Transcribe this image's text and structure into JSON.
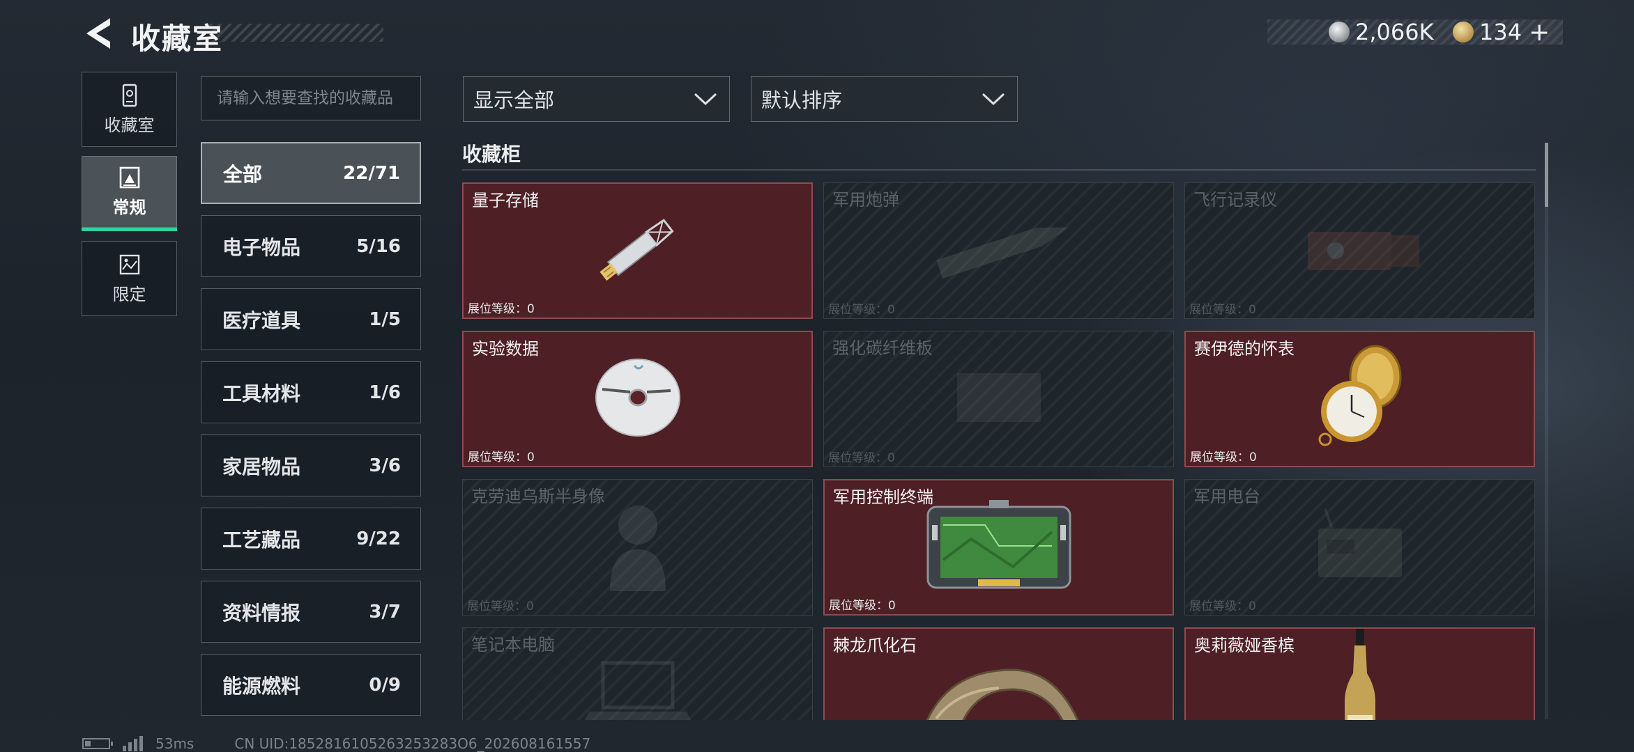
{
  "header": {
    "title": "收藏室",
    "currencies": [
      {
        "icon": "silver-coin-icon",
        "value": "2,066K"
      },
      {
        "icon": "gold-coin-icon",
        "value": "134"
      }
    ],
    "add_label": "+"
  },
  "nav": [
    {
      "label": "收藏室",
      "icon": "locker-icon",
      "active": false
    },
    {
      "label": "常规",
      "icon": "regular-collection-icon",
      "active": true
    },
    {
      "label": "限定",
      "icon": "limited-collection-icon",
      "active": false
    }
  ],
  "search": {
    "placeholder": "请输入想要查找的收藏品",
    "value": ""
  },
  "categories": [
    {
      "name": "全部",
      "count": "22/71",
      "active": true
    },
    {
      "name": "电子物品",
      "count": "5/16"
    },
    {
      "name": "医疗道具",
      "count": "1/5"
    },
    {
      "name": "工具材料",
      "count": "1/6"
    },
    {
      "name": "家居物品",
      "count": "3/6"
    },
    {
      "name": "工艺藏品",
      "count": "9/22"
    },
    {
      "name": "资料情报",
      "count": "3/7"
    },
    {
      "name": "能源燃料",
      "count": "0/9"
    }
  ],
  "filters": {
    "display": "显示全部",
    "sort": "默认排序"
  },
  "cabinet": {
    "title": "收藏柜",
    "level_label": "展位等级：",
    "items": [
      {
        "name": "量子存储",
        "level": "0",
        "owned": true,
        "art": "usb"
      },
      {
        "name": "军用炮弹",
        "level": "0",
        "owned": false,
        "art": "shell"
      },
      {
        "name": "飞行记录仪",
        "level": "0",
        "owned": false,
        "art": "recorder"
      },
      {
        "name": "实验数据",
        "level": "0",
        "owned": true,
        "art": "disc"
      },
      {
        "name": "强化碳纤维板",
        "level": "0",
        "owned": false,
        "art": "plate"
      },
      {
        "name": "赛伊德的怀表",
        "level": "0",
        "owned": true,
        "art": "watch"
      },
      {
        "name": "克劳迪乌斯半身像",
        "level": "0",
        "owned": false,
        "art": "bust"
      },
      {
        "name": "军用控制终端",
        "level": "0",
        "owned": true,
        "art": "terminal"
      },
      {
        "name": "军用电台",
        "level": "0",
        "owned": false,
        "art": "radio"
      },
      {
        "name": "笔记本电脑",
        "level": "",
        "owned": false,
        "art": "laptop"
      },
      {
        "name": "棘龙爪化石",
        "level": "",
        "owned": true,
        "art": "claw"
      },
      {
        "name": "奥莉薇娅香槟",
        "level": "",
        "owned": true,
        "art": "champagne"
      }
    ]
  },
  "footer": {
    "ping": "53ms",
    "uid": "CN UID:1852816105263253283O6_202608161557"
  }
}
